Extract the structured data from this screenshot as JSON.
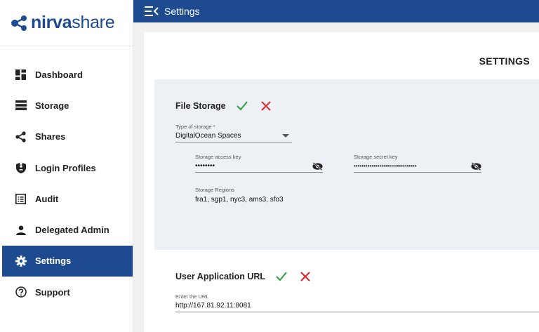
{
  "brand": {
    "part1": "nirva",
    "part2": "share"
  },
  "sidebar": {
    "items": [
      {
        "label": "Dashboard",
        "icon": "dashboard-icon",
        "active": false
      },
      {
        "label": "Storage",
        "icon": "storage-icon",
        "active": false
      },
      {
        "label": "Shares",
        "icon": "share-icon",
        "active": false
      },
      {
        "label": "Login Profiles",
        "icon": "shield-icon",
        "active": false
      },
      {
        "label": "Audit",
        "icon": "audit-list-icon",
        "active": false
      },
      {
        "label": "Delegated Admin",
        "icon": "person-icon",
        "active": false
      },
      {
        "label": "Settings",
        "icon": "gear-icon",
        "active": true
      },
      {
        "label": "Support",
        "icon": "help-icon",
        "active": false
      }
    ]
  },
  "topbar": {
    "title": "Settings"
  },
  "page": {
    "title": "SETTINGS"
  },
  "file_storage": {
    "title": "File Storage",
    "type_label": "Type of storage *",
    "type_value": "DigitalOcean Spaces",
    "access_key_label": "Storage access key",
    "access_key_value": "••••••••",
    "secret_key_label": "Storage secret key",
    "secret_key_value": "••••••••••••••••••••••••••••••••",
    "regions_label": "Storage Regions",
    "regions_value": "fra1, sgp1, nyc3, ams3, sfo3"
  },
  "user_app_url": {
    "title": "User Application URL",
    "url_label": "Enter the URL",
    "url_value": "http://167.81.92.11:8081"
  },
  "colors": {
    "brand": "#1e4b8f",
    "check": "#2e9e3e",
    "cross": "#e0262b"
  }
}
